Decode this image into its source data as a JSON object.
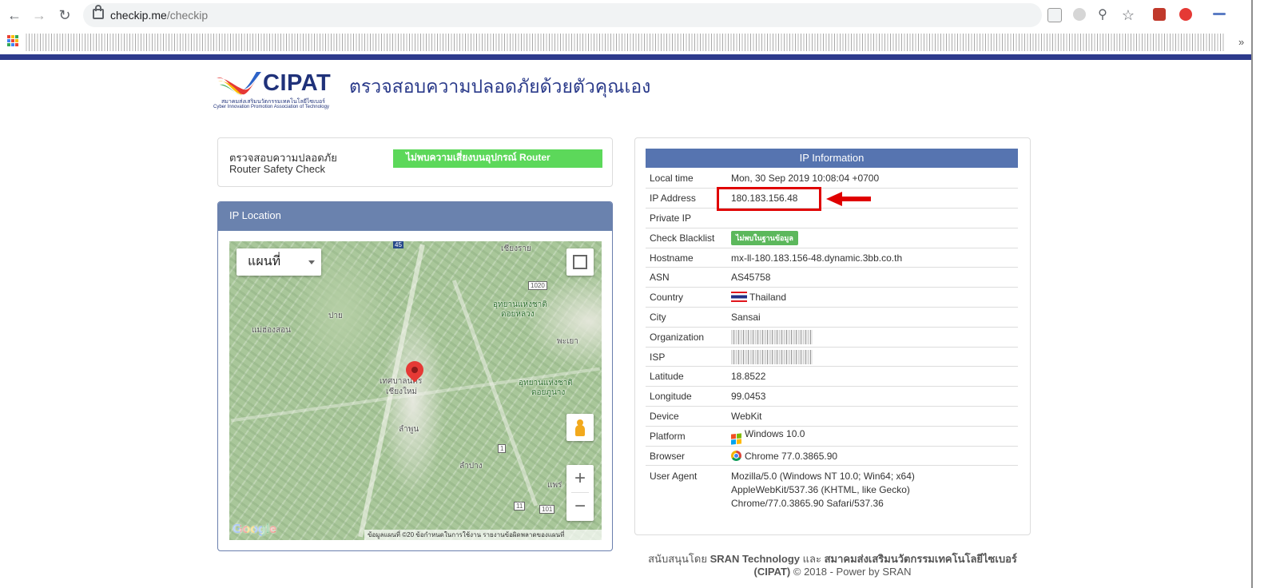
{
  "browser": {
    "url_domain": "checkip.me",
    "url_path": "/checkip",
    "bookmarks_more": "»"
  },
  "header": {
    "logo_wordmark": "CIPAT",
    "logo_tagline_th": "สมาคมส่งเสริมนวัตกรรมเทคโนโลยีไซเบอร์",
    "logo_tagline_en": "Cyber Innovation Promotion Association of Technology",
    "title": "ตรวจสอบความปลอดภัยด้วยตัวคุณเอง"
  },
  "router_check": {
    "label_th": "ตรวจสอบความปลอดภัย",
    "label_en": "Router Safety Check",
    "status": "ไม่พบความเสี่ยงบนอุปกรณ์ Router",
    "status_color": "#5cd85a"
  },
  "ip_location": {
    "heading": "IP Location",
    "map_type": "แผนที่",
    "labels": {
      "chiangrai": "เชียงราย",
      "road45": "45",
      "road1020": "1020",
      "maehongson": "แม่ฮ่องสอน",
      "pai": "ปาย",
      "np1": "อุทยานแห่งชาติ",
      "np1b": "ดอยหลวง",
      "phayao": "พะเยา",
      "city1": "เทศบาลนคร",
      "city2": "เชียงใหม่",
      "np2": "อุทยานแห่งชาติ",
      "np2b": "ดอยภูนาง",
      "lamphun": "ลำพูน",
      "lampang": "ลำปาง",
      "phrae": "แพร่",
      "road1": "1",
      "road11": "11",
      "road101": "101"
    },
    "google": "Google",
    "attribution": "ข้อมูลแผนที่ ©20  ข้อกำหนดในการใช้งาน  รายงานข้อผิดพลาดของแผนที่",
    "zoom_in": "+",
    "zoom_out": "−"
  },
  "ip_info": {
    "heading": "IP Information",
    "rows": [
      {
        "key": "Local time",
        "value": "Mon, 30 Sep 2019 10:08:04 +0700"
      },
      {
        "key": "IP Address",
        "value": "180.183.156.48"
      },
      {
        "key": "Private IP",
        "value": ""
      },
      {
        "key": "Check Blacklist",
        "value": "ไม่พบในฐานข้อมูล"
      },
      {
        "key": "Hostname",
        "value": "mx-ll-180.183.156-48.dynamic.3bb.co.th"
      },
      {
        "key": "ASN",
        "value": "AS45758"
      },
      {
        "key": "Country",
        "value": "Thailand"
      },
      {
        "key": "City",
        "value": "Sansai"
      },
      {
        "key": "Organization",
        "value": ""
      },
      {
        "key": "ISP",
        "value": ""
      },
      {
        "key": "Latitude",
        "value": "18.8522"
      },
      {
        "key": "Longitude",
        "value": "99.0453"
      },
      {
        "key": "Device",
        "value": "WebKit"
      },
      {
        "key": "Platform",
        "value": "Windows 10.0"
      },
      {
        "key": "Browser",
        "value": "Chrome 77.0.3865.90"
      },
      {
        "key": "User Agent",
        "value_lines": [
          "Mozilla/5.0 (Windows NT 10.0; Win64; x64)",
          "AppleWebKit/537.36 (KHTML, like Gecko)",
          "Chrome/77.0.3865.90 Safari/537.36"
        ]
      }
    ]
  },
  "footer": {
    "line1_prefix": "สนับสนุนโดย ",
    "line1_bold1": "SRAN Technology",
    "line1_mid": " และ ",
    "line1_bold2": "สมาคมส่งเสริมนวัตกรรมเทคโนโลยีไซเบอร์",
    "line2_bold": "(CIPAT)",
    "line2_rest": " © 2018 - Power by SRAN"
  },
  "colors": {
    "brand_navy": "#2d3a8c",
    "panel_header": "#6a82ae",
    "info_header": "#5674b0",
    "annotation_red": "#e00000"
  }
}
